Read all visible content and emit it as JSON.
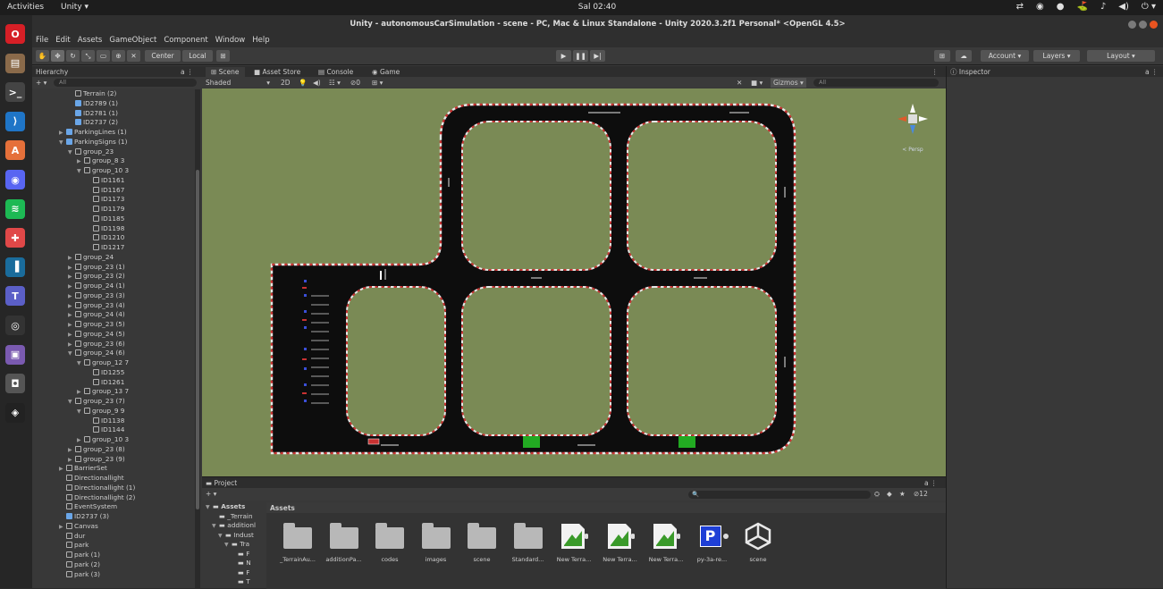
{
  "topbar": {
    "activities": "Activities",
    "app": "Unity ▾",
    "clock": "Sal 02:40",
    "tray": [
      "⇄",
      "◉",
      "●",
      "⛳",
      "♪",
      "◀)",
      "⏻ ▾"
    ]
  },
  "dock": {
    "items": [
      {
        "name": "opera-icon",
        "glyph": "O",
        "color": "#d61f26"
      },
      {
        "name": "files-icon",
        "glyph": "▤",
        "color": "#8a6a4a"
      },
      {
        "name": "terminal-icon",
        "glyph": ">_",
        "color": "#444"
      },
      {
        "name": "vscode-icon",
        "glyph": "⟩",
        "color": "#1f75c7"
      },
      {
        "name": "software-icon",
        "glyph": "A",
        "color": "#e5703a"
      },
      {
        "name": "discord-icon",
        "glyph": "◉",
        "color": "#5865f2"
      },
      {
        "name": "spotify-icon",
        "glyph": "≋",
        "color": "#1db954"
      },
      {
        "name": "lifebuoy-icon",
        "glyph": "✚",
        "color": "#e04848"
      },
      {
        "name": "panel-icon",
        "glyph": "▐",
        "color": "#1a6c9c"
      },
      {
        "name": "teams-icon",
        "glyph": "T",
        "color": "#5b5fc7"
      },
      {
        "name": "obs-icon",
        "glyph": "◎",
        "color": "#333"
      },
      {
        "name": "image-viewer-icon",
        "glyph": "▣",
        "color": "#7a5ab0"
      },
      {
        "name": "camera-icon",
        "glyph": "◘",
        "color": "#555"
      },
      {
        "name": "unity-hub-icon",
        "glyph": "◈",
        "color": "#222"
      }
    ]
  },
  "window": {
    "title": "Unity - autonomousCarSimulation - scene - PC, Mac & Linux Standalone - Unity 2020.3.2f1 Personal* <OpenGL 4.5>"
  },
  "menu": [
    "File",
    "Edit",
    "Assets",
    "GameObject",
    "Component",
    "Window",
    "Help"
  ],
  "toolbar": {
    "center": "Center",
    "local": "Local",
    "account": "Account ▾",
    "layers": "Layers ▾",
    "layout": "Layout ▾"
  },
  "hierarchy": {
    "tab": "Hierarchy",
    "search_placeholder": "All",
    "rows": [
      {
        "t": "Terrain (2)",
        "d": 1,
        "a": "",
        "blue": false
      },
      {
        "t": "ID2789 (1)",
        "d": 1,
        "a": "",
        "blue": true
      },
      {
        "t": "ID2781 (1)",
        "d": 1,
        "a": "",
        "blue": true
      },
      {
        "t": "ID2737 (2)",
        "d": 1,
        "a": "",
        "blue": true
      },
      {
        "t": "ParkingLines (1)",
        "d": 0,
        "a": "▶",
        "blue": true
      },
      {
        "t": "ParkingSigns (1)",
        "d": 0,
        "a": "▼",
        "blue": true
      },
      {
        "t": "group_23",
        "d": 1,
        "a": "▼",
        "blue": false
      },
      {
        "t": "group_8 3",
        "d": 2,
        "a": "▶",
        "blue": false
      },
      {
        "t": "group_10 3",
        "d": 2,
        "a": "▼",
        "blue": false
      },
      {
        "t": "ID1161",
        "d": 3,
        "a": "",
        "blue": false
      },
      {
        "t": "ID1167",
        "d": 3,
        "a": "",
        "blue": false
      },
      {
        "t": "ID1173",
        "d": 3,
        "a": "",
        "blue": false
      },
      {
        "t": "ID1179",
        "d": 3,
        "a": "",
        "blue": false
      },
      {
        "t": "ID1185",
        "d": 3,
        "a": "",
        "blue": false
      },
      {
        "t": "ID1198",
        "d": 3,
        "a": "",
        "blue": false
      },
      {
        "t": "ID1210",
        "d": 3,
        "a": "",
        "blue": false
      },
      {
        "t": "ID1217",
        "d": 3,
        "a": "",
        "blue": false
      },
      {
        "t": "group_24",
        "d": 1,
        "a": "▶",
        "blue": false
      },
      {
        "t": "group_23 (1)",
        "d": 1,
        "a": "▶",
        "blue": false
      },
      {
        "t": "group_23 (2)",
        "d": 1,
        "a": "▶",
        "blue": false
      },
      {
        "t": "group_24 (1)",
        "d": 1,
        "a": "▶",
        "blue": false
      },
      {
        "t": "group_23 (3)",
        "d": 1,
        "a": "▶",
        "blue": false
      },
      {
        "t": "group_23 (4)",
        "d": 1,
        "a": "▶",
        "blue": false
      },
      {
        "t": "group_24 (4)",
        "d": 1,
        "a": "▶",
        "blue": false
      },
      {
        "t": "group_23 (5)",
        "d": 1,
        "a": "▶",
        "blue": false
      },
      {
        "t": "group_24 (5)",
        "d": 1,
        "a": "▶",
        "blue": false
      },
      {
        "t": "group_23 (6)",
        "d": 1,
        "a": "▶",
        "blue": false
      },
      {
        "t": "group_24 (6)",
        "d": 1,
        "a": "▼",
        "blue": false
      },
      {
        "t": "group_12 7",
        "d": 2,
        "a": "▼",
        "blue": false
      },
      {
        "t": "ID1255",
        "d": 3,
        "a": "",
        "blue": false
      },
      {
        "t": "ID1261",
        "d": 3,
        "a": "",
        "blue": false
      },
      {
        "t": "group_13 7",
        "d": 2,
        "a": "▶",
        "blue": false
      },
      {
        "t": "group_23 (7)",
        "d": 1,
        "a": "▼",
        "blue": false
      },
      {
        "t": "group_9 9",
        "d": 2,
        "a": "▼",
        "blue": false
      },
      {
        "t": "ID1138",
        "d": 3,
        "a": "",
        "blue": false
      },
      {
        "t": "ID1144",
        "d": 3,
        "a": "",
        "blue": false
      },
      {
        "t": "group_10 3",
        "d": 2,
        "a": "▶",
        "blue": false
      },
      {
        "t": "group_23 (8)",
        "d": 1,
        "a": "▶",
        "blue": false
      },
      {
        "t": "group_23 (9)",
        "d": 1,
        "a": "▶",
        "blue": false
      },
      {
        "t": "BarrierSet",
        "d": 0,
        "a": "▶",
        "blue": false
      },
      {
        "t": "Directionallight",
        "d": 0,
        "a": "",
        "blue": false
      },
      {
        "t": "Directionallight (1)",
        "d": 0,
        "a": "",
        "blue": false
      },
      {
        "t": "Directionallight (2)",
        "d": 0,
        "a": "",
        "blue": false
      },
      {
        "t": "EventSystem",
        "d": 0,
        "a": "",
        "blue": false
      },
      {
        "t": "ID2737 (3)",
        "d": 0,
        "a": "",
        "blue": true
      },
      {
        "t": "Canvas",
        "d": 0,
        "a": "▶",
        "blue": false
      },
      {
        "t": "dur",
        "d": 0,
        "a": "",
        "blue": false
      },
      {
        "t": "park",
        "d": 0,
        "a": "",
        "blue": false
      },
      {
        "t": "park (1)",
        "d": 0,
        "a": "",
        "blue": false
      },
      {
        "t": "park (2)",
        "d": 0,
        "a": "",
        "blue": false
      },
      {
        "t": "park (3)",
        "d": 0,
        "a": "",
        "blue": false
      }
    ]
  },
  "scene": {
    "tabs": [
      "Scene",
      "Asset Store",
      "Console",
      "Game"
    ],
    "shading": "Shaded",
    "mode": "2D",
    "gizmos": "Gizmos ▾",
    "search_placeholder": "All",
    "persp": "< Persp"
  },
  "inspector": {
    "tab": "Inspector"
  },
  "project": {
    "tab": "Project",
    "breadcrumb": "Assets",
    "count": "12",
    "tree": [
      {
        "t": "Assets",
        "d": 0,
        "a": "▼"
      },
      {
        "t": "_Terrain",
        "d": 1,
        "a": ""
      },
      {
        "t": "additionl",
        "d": 1,
        "a": "▼"
      },
      {
        "t": "Indust",
        "d": 2,
        "a": "▼"
      },
      {
        "t": "Tra",
        "d": 3,
        "a": "▼"
      },
      {
        "t": "F",
        "d": 4,
        "a": ""
      },
      {
        "t": "N",
        "d": 4,
        "a": ""
      },
      {
        "t": "F",
        "d": 4,
        "a": ""
      },
      {
        "t": "T",
        "d": 4,
        "a": ""
      }
    ],
    "assets": [
      {
        "label": "_TerrainAu...",
        "kind": "folder"
      },
      {
        "label": "additionPa...",
        "kind": "folder"
      },
      {
        "label": "codes",
        "kind": "folder"
      },
      {
        "label": "images",
        "kind": "folder"
      },
      {
        "label": "scene",
        "kind": "folder"
      },
      {
        "label": "Standard...",
        "kind": "folder"
      },
      {
        "label": "New Terra...",
        "kind": "terrain"
      },
      {
        "label": "New Terra...",
        "kind": "terrain"
      },
      {
        "label": "New Terra...",
        "kind": "terrain"
      },
      {
        "label": "py-3a-re...",
        "kind": "parking",
        "glyph": "P"
      },
      {
        "label": "scene",
        "kind": "unity"
      }
    ]
  }
}
